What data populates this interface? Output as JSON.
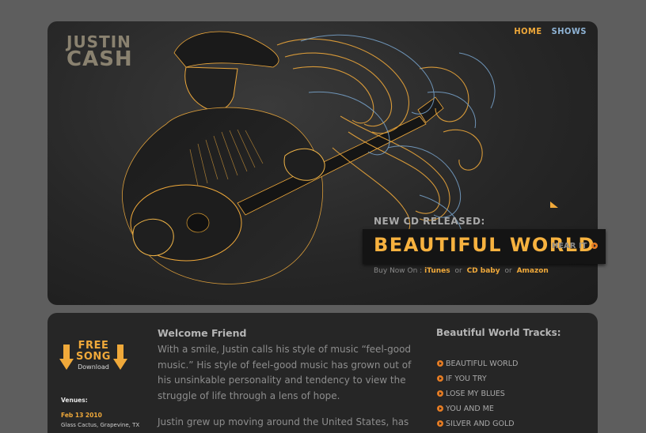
{
  "brand": {
    "line1": "JUSTIN",
    "line2": "CASH"
  },
  "nav": {
    "items": [
      "HOME",
      "SHOWS"
    ]
  },
  "hero": {
    "kicker": "NEW CD RELEASED:",
    "title": "BEAUTIFUL WORLD",
    "hear_label": "HEAR IT",
    "buy_label": "Buy Now On :",
    "stores": [
      "iTunes",
      "CD baby",
      "Amazon"
    ],
    "or_text": "or"
  },
  "free_song": {
    "title_line1": "FREE",
    "title_line2": "SONG",
    "sub": "Download"
  },
  "venues": {
    "heading": "Venues:",
    "date": "Feb 13 2010",
    "place": "Glass Cactus, Grapevine, TX"
  },
  "welcome": {
    "heading": "Welcome Friend",
    "para1": "With a smile, Justin calls his style of music “feel-good music.” His style of feel-good music has grown out of his unsinkable personality and tendency to view the struggle of life through a lens of hope.",
    "para2": "Justin grew up moving around the United States, has spent"
  },
  "tracks": {
    "heading": "Beautiful World Tracks:",
    "items": [
      "BEAUTIFUL WORLD",
      "IF YOU TRY",
      "LOSE MY BLUES",
      "YOU AND ME",
      "SILVER AND GOLD"
    ]
  },
  "colors": {
    "accent": "#f0a93a",
    "nav_secondary": "#8fb4d6",
    "bullet": "#e67c23"
  }
}
